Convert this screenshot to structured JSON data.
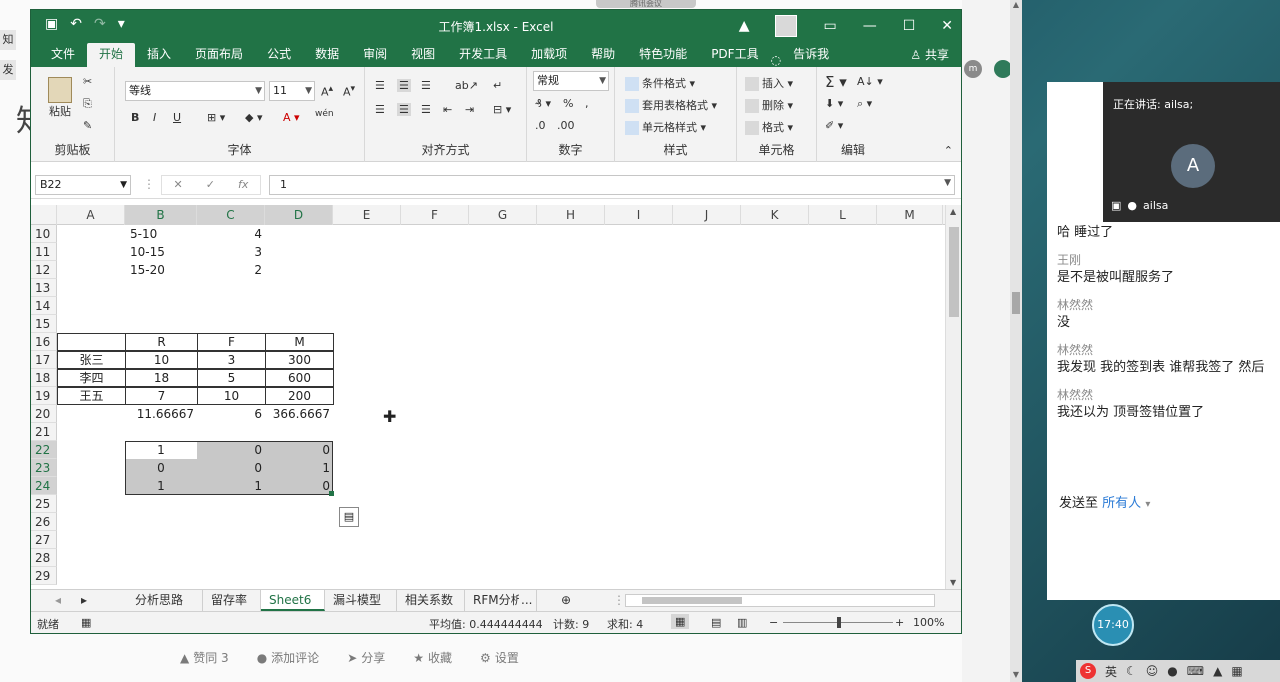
{
  "bg_page": {
    "left_tabs": [
      "知",
      "发"
    ],
    "big_char": "知",
    "strip_badge": "m",
    "bottom_bar": {
      "like": "赞同 3",
      "comment": "添加评论",
      "share": "分享",
      "favorite": "收藏",
      "settings": "设置"
    }
  },
  "meeting_top_tab": "腾讯会议",
  "excel": {
    "title": "工作簿1.xlsx - Excel",
    "share": "共享",
    "menu": [
      "文件",
      "开始",
      "插入",
      "页面布局",
      "公式",
      "数据",
      "审阅",
      "视图",
      "开发工具",
      "加载项",
      "帮助",
      "特色功能",
      "PDF工具",
      "告诉我"
    ],
    "active_menu": "开始",
    "ribbon": {
      "clipboard": {
        "paste": "粘贴",
        "label": "剪贴板"
      },
      "font": {
        "name": "等线",
        "size": "11",
        "label": "字体",
        "bold": "B",
        "italic": "I",
        "underline": "U",
        "pinyin": "wén"
      },
      "align": {
        "label": "对齐方式"
      },
      "number": {
        "format": "常规",
        "label": "数字"
      },
      "styles": {
        "cond": "条件格式",
        "table": "套用表格格式",
        "cell": "单元格样式",
        "label": "样式"
      },
      "cells": {
        "insert": "插入",
        "delete": "删除",
        "format": "格式",
        "label": "单元格"
      },
      "editing": {
        "label": "编辑"
      }
    },
    "formula_bar": {
      "namebox": "B22",
      "formula": "1",
      "fx": "fx"
    },
    "columns": [
      "A",
      "B",
      "C",
      "D",
      "E",
      "F",
      "G",
      "H",
      "I",
      "J",
      "K",
      "L",
      "M"
    ],
    "rows": [
      "10",
      "11",
      "12",
      "13",
      "14",
      "15",
      "16",
      "17",
      "18",
      "19",
      "20",
      "21",
      "22",
      "23",
      "24",
      "25",
      "26",
      "27",
      "28",
      "29"
    ],
    "cells": {
      "b10": "5-10",
      "c10": "4",
      "b11": "10-15",
      "c11": "3",
      "b12": "15-20",
      "c12": "2",
      "h16_r": "R",
      "h16_f": "F",
      "h16_m": "M",
      "a17": "张三",
      "b17": "10",
      "c17": "3",
      "d17": "300",
      "a18": "李四",
      "b18": "18",
      "c18": "5",
      "d18": "600",
      "a19": "王五",
      "b19": "7",
      "c19": "10",
      "d19": "200",
      "b20": "11.66667",
      "c20": "6",
      "d20": "366.6667",
      "b22": "1",
      "c22": "0",
      "d22": "0",
      "b23": "0",
      "c23": "0",
      "d23": "1",
      "b24": "1",
      "c24": "1",
      "d24": "0"
    },
    "sheets": [
      "分析思路",
      "留存率",
      "Sheet6",
      "漏斗模型",
      "相关系数",
      "RFM分析"
    ],
    "active_sheet": "Sheet6",
    "more_sheets": "...",
    "status": {
      "ready": "就绪",
      "average": "平均值: 0.444444444",
      "count": "计数: 9",
      "sum": "求和: 4",
      "zoom": "100%"
    }
  },
  "meeting": {
    "speaking": "正在讲话: ailsa;",
    "avatar_letter": "A",
    "speaker_name": "ailsa",
    "messages": [
      {
        "name": "",
        "text": "哈  睡过了"
      },
      {
        "name": "王刚",
        "text": "是不是被叫醒服务了"
      },
      {
        "name": "林然然",
        "text": "没"
      },
      {
        "name": "林然然",
        "text": "我发现 我的签到表 谁帮我签了  然后"
      },
      {
        "name": "林然然",
        "text": "我还以为 顶哥签错位置了"
      }
    ],
    "send_to_label": "发送至",
    "send_to_target": "所有人",
    "clock": "17:40",
    "tray_ime": "英"
  },
  "colors": {
    "excel_green": "#217346",
    "selection": "#c8c8c8",
    "meeting_dark": "#2b2b2b",
    "link_blue": "#2b7bd6"
  }
}
